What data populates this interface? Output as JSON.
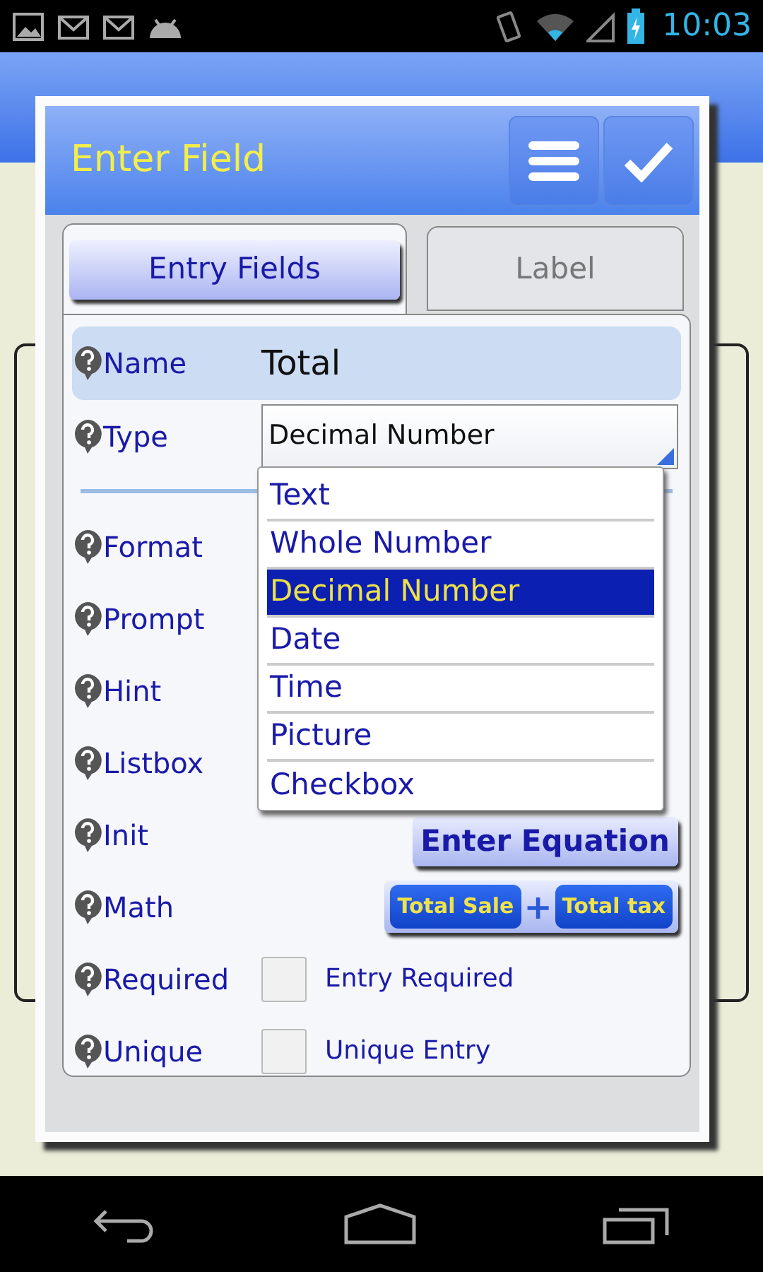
{
  "status_bar": {
    "time": "10:03"
  },
  "dialog": {
    "title": "Enter Field",
    "tabs": [
      {
        "label": "Entry Fields",
        "selected": true
      },
      {
        "label": "Label",
        "selected": false
      }
    ],
    "fields": [
      {
        "kind": "text",
        "label": "Name",
        "value": "Total",
        "highlighted": true
      },
      {
        "kind": "select",
        "label": "Type",
        "value": "Decimal Number",
        "highlighted": false
      },
      {
        "kind": "separator"
      },
      {
        "kind": "empty",
        "label": "Format",
        "highlighted": false
      },
      {
        "kind": "empty",
        "label": "Prompt",
        "highlighted": false
      },
      {
        "kind": "empty",
        "label": "Hint",
        "highlighted": false
      },
      {
        "kind": "empty",
        "label": "Listbox",
        "highlighted": false
      },
      {
        "kind": "button",
        "label": "Init",
        "button": "Enter Equation",
        "highlighted": false
      },
      {
        "kind": "equation",
        "label": "Math",
        "operands": [
          "Total Sale",
          "Total tax"
        ],
        "operator": "+",
        "highlighted": false
      },
      {
        "kind": "checkbox",
        "label": "Required",
        "caption": "Entry Required",
        "checked": false,
        "highlighted": false
      },
      {
        "kind": "checkbox",
        "label": "Unique",
        "caption": "Unique Entry",
        "checked": false,
        "highlighted": false
      }
    ],
    "dropdown": {
      "options": [
        {
          "label": "Text",
          "selected": false
        },
        {
          "label": "Whole Number",
          "selected": false
        },
        {
          "label": "Decimal Number",
          "selected": true
        },
        {
          "label": "Date",
          "selected": false
        },
        {
          "label": "Time",
          "selected": false
        },
        {
          "label": "Picture",
          "selected": false
        },
        {
          "label": "Checkbox",
          "selected": false
        }
      ]
    }
  }
}
